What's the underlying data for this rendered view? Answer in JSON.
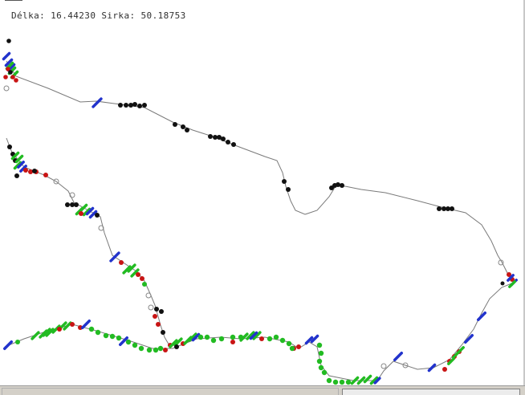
{
  "coordinates": {
    "label": "Délka: 16.44230 Sirka: 50.18753"
  },
  "colors": {
    "background": "#ffffff",
    "route_line": "#7a7a7a",
    "black_marker": "#111111",
    "red_marker": "#c81414",
    "green_marker": "#22bb22",
    "blue_marker": "#2233cc",
    "status_bar": "#d4d0c8"
  },
  "legend_icons": [
    "black-dot-icon",
    "red-dot-icon",
    "green-dot-icon",
    "blue-dash-icon",
    "grey-circle-icon"
  ]
}
